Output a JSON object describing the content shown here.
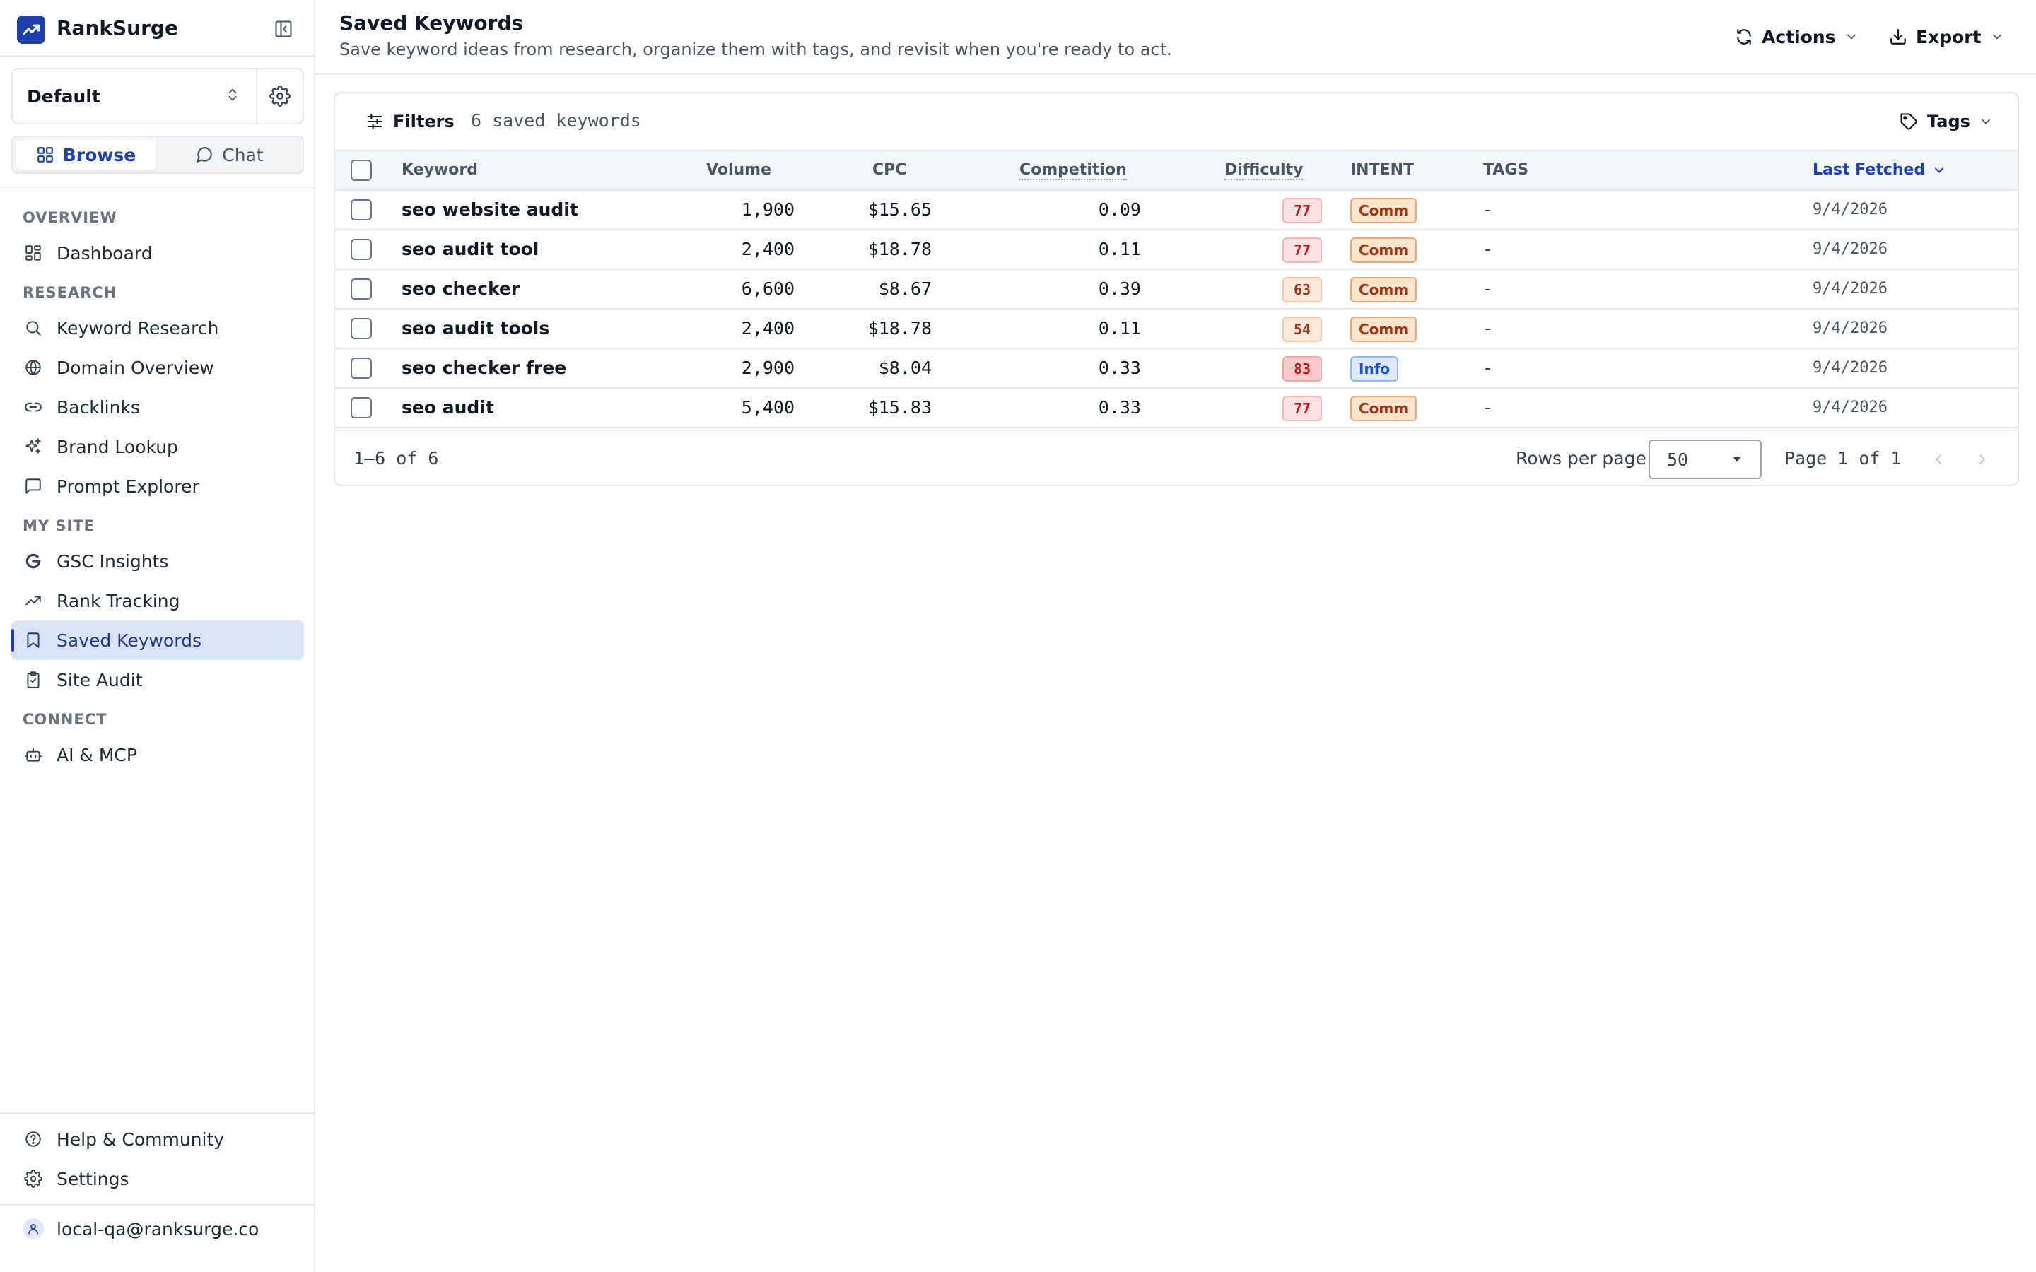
{
  "app": {
    "name": "RankSurge"
  },
  "project": {
    "name": "Default"
  },
  "modes": {
    "browse": "Browse",
    "chat": "Chat"
  },
  "sidebar": {
    "sections": {
      "overview": "OVERVIEW",
      "research": "RESEARCH",
      "my_site": "MY SITE",
      "connect": "CONNECT"
    },
    "items": {
      "dashboard": "Dashboard",
      "keyword_research": "Keyword Research",
      "domain_overview": "Domain Overview",
      "backlinks": "Backlinks",
      "brand_lookup": "Brand Lookup",
      "prompt_explorer": "Prompt Explorer",
      "gsc_insights": "GSC Insights",
      "rank_tracking": "Rank Tracking",
      "saved_keywords": "Saved Keywords",
      "site_audit": "Site Audit",
      "ai_mcp": "AI & MCP"
    },
    "bottom": {
      "help": "Help & Community",
      "settings": "Settings"
    },
    "user_email": "local-qa@ranksurge.co",
    "active_item": "saved_keywords"
  },
  "header": {
    "title": "Saved Keywords",
    "subtitle": "Save keyword ideas from research, organize them with tags, and revisit when you're ready to act.",
    "actions_label": "Actions",
    "export_label": "Export"
  },
  "toolbar": {
    "filters_label": "Filters",
    "count_text": "6 saved keywords",
    "tags_label": "Tags"
  },
  "table": {
    "columns": {
      "keyword": "Keyword",
      "volume": "Volume",
      "cpc": "CPC",
      "competition": "Competition",
      "difficulty": "Difficulty",
      "intent": "INTENT",
      "tags": "TAGS",
      "last_fetched": "Last Fetched"
    },
    "sorted_by": "last_fetched",
    "rows": [
      {
        "keyword": "seo website audit",
        "volume": "1,900",
        "cpc": "$15.65",
        "competition": "0.09",
        "difficulty": "77",
        "intent": "Comm",
        "tags": "-",
        "last_fetched": "9/4/2026"
      },
      {
        "keyword": "seo audit tool",
        "volume": "2,400",
        "cpc": "$18.78",
        "competition": "0.11",
        "difficulty": "77",
        "intent": "Comm",
        "tags": "-",
        "last_fetched": "9/4/2026"
      },
      {
        "keyword": "seo checker",
        "volume": "6,600",
        "cpc": "$8.67",
        "competition": "0.39",
        "difficulty": "63",
        "intent": "Comm",
        "tags": "-",
        "last_fetched": "9/4/2026"
      },
      {
        "keyword": "seo audit tools",
        "volume": "2,400",
        "cpc": "$18.78",
        "competition": "0.11",
        "difficulty": "54",
        "intent": "Comm",
        "tags": "-",
        "last_fetched": "9/4/2026"
      },
      {
        "keyword": "seo checker free",
        "volume": "2,900",
        "cpc": "$8.04",
        "competition": "0.33",
        "difficulty": "83",
        "intent": "Info",
        "tags": "-",
        "last_fetched": "9/4/2026"
      },
      {
        "keyword": "seo audit",
        "volume": "5,400",
        "cpc": "$15.83",
        "competition": "0.33",
        "difficulty": "77",
        "intent": "Comm",
        "tags": "-",
        "last_fetched": "9/4/2026"
      }
    ]
  },
  "pagination": {
    "range_text": "1–6 of 6",
    "rows_per_page_label": "Rows per page",
    "rows_per_page_value": "50",
    "page_text": "Page 1 of 1"
  },
  "colors": {
    "accent": "#1e40af",
    "active_nav_bg": "#dbe4f7",
    "difficulty_hard_bg": "#fde2e2",
    "difficulty_hard_text": "#b91c1c",
    "difficulty_very_hard_bg": "#f9caca",
    "difficulty_medium_bg": "#fde9dc",
    "difficulty_medium_text": "#9a3412",
    "intent_comm_bg": "#fde4cc",
    "intent_comm_text": "#9a3412",
    "intent_info_bg": "#dbeafe",
    "intent_info_text": "#1d4ed8"
  }
}
